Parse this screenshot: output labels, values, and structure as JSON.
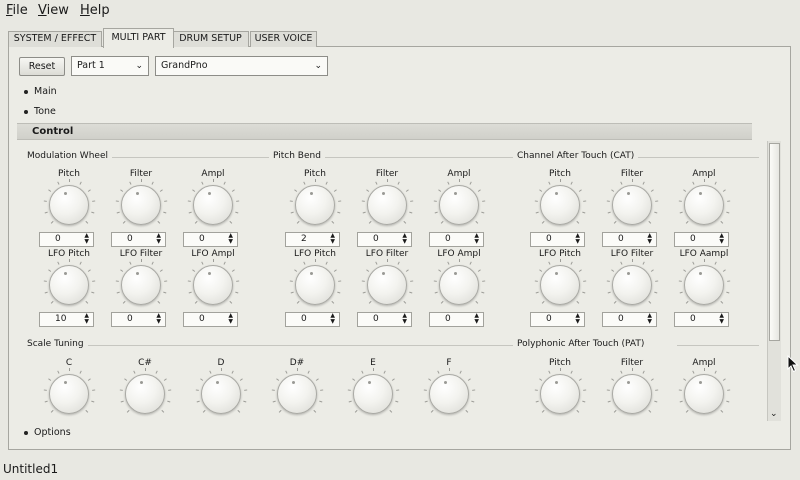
{
  "menubar": {
    "items": [
      {
        "label": "File",
        "first": "F",
        "rest": "ile"
      },
      {
        "label": "View",
        "first": "V",
        "rest": "iew"
      },
      {
        "label": "Help",
        "first": "H",
        "rest": "elp"
      }
    ]
  },
  "tabs": [
    "SYSTEM / EFFECT",
    "MULTI PART",
    "DRUM SETUP",
    "USER VOICE"
  ],
  "active_tab": "MULTI PART",
  "toolbar": {
    "reset_label": "Reset",
    "part": "Part 1",
    "voice": "GrandPno"
  },
  "sections": {
    "main": "Main",
    "tone": "Tone",
    "control": "Control",
    "options": "Options"
  },
  "groups": {
    "modulation_wheel": {
      "title": "Modulation Wheel",
      "row1": [
        {
          "label": "Pitch",
          "value": "0"
        },
        {
          "label": "Filter",
          "value": "0"
        },
        {
          "label": "Ampl",
          "value": "0"
        }
      ],
      "row2": [
        {
          "label": "LFO Pitch",
          "value": "10"
        },
        {
          "label": "LFO Filter",
          "value": "0"
        },
        {
          "label": "LFO Ampl",
          "value": "0"
        }
      ]
    },
    "pitch_bend": {
      "title": "Pitch Bend",
      "row1": [
        {
          "label": "Pitch",
          "value": "2"
        },
        {
          "label": "Filter",
          "value": "0"
        },
        {
          "label": "Ampl",
          "value": "0"
        }
      ],
      "row2": [
        {
          "label": "LFO Pitch",
          "value": "0"
        },
        {
          "label": "LFO Filter",
          "value": "0"
        },
        {
          "label": "LFO Ampl",
          "value": "0"
        }
      ]
    },
    "channel_after_touch": {
      "title": "Channel After Touch (CAT)",
      "row1": [
        {
          "label": "Pitch",
          "value": "0"
        },
        {
          "label": "Filter",
          "value": "0"
        },
        {
          "label": "Ampl",
          "value": "0"
        }
      ],
      "row2": [
        {
          "label": "LFO Pitch",
          "value": "0"
        },
        {
          "label": "LFO Filter",
          "value": "0"
        },
        {
          "label": "LFO Aampl",
          "value": "0"
        }
      ]
    },
    "scale_tuning": {
      "title": "Scale Tuning",
      "notes": [
        {
          "label": "C"
        },
        {
          "label": "C#"
        },
        {
          "label": "D"
        },
        {
          "label": "D#"
        },
        {
          "label": "E"
        },
        {
          "label": "F"
        }
      ]
    },
    "polyphonic_after_touch": {
      "title": "Polyphonic After Touch (PAT)",
      "row1": [
        {
          "label": "Pitch"
        },
        {
          "label": "Filter"
        },
        {
          "label": "Ampl"
        }
      ]
    }
  },
  "status": "Untitled1"
}
